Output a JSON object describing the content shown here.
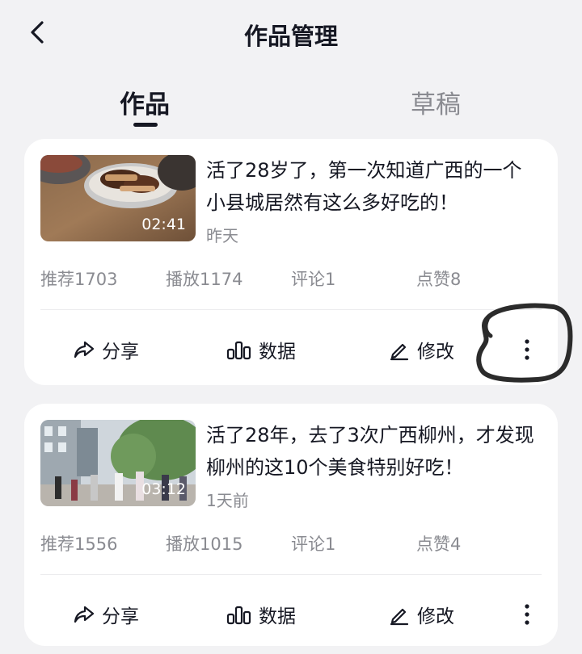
{
  "header": {
    "title": "作品管理",
    "back_icon": "chevron-left-icon"
  },
  "tabs": [
    {
      "label": "作品",
      "active": true
    },
    {
      "label": "草稿",
      "active": false
    }
  ],
  "works": [
    {
      "title": "活了28岁了，第一次知道广西的一个小县城居然有这么多好吃的！",
      "duration": "02:41",
      "date": "昨天",
      "stats": {
        "recommend": "推荐1703",
        "play": "播放1174",
        "comment": "评论1",
        "like": "点赞8"
      },
      "thumbnail": "braised-pork-dish-image"
    },
    {
      "title": "活了28年，去了3次广西柳州，才发现柳州的这10个美食特别好吃！",
      "duration": "03:12",
      "date": "1天前",
      "stats": {
        "recommend": "推荐1556",
        "play": "播放1015",
        "comment": "评论1",
        "like": "点赞4"
      },
      "thumbnail": "city-street-crowd-image"
    }
  ],
  "actions": {
    "share": "分享",
    "data": "数据",
    "edit": "修改",
    "more_icon": "more-vertical-icon"
  },
  "annotation": {
    "type": "hand-drawn-circle",
    "target": "more-button",
    "color": "#2b2b2b"
  }
}
